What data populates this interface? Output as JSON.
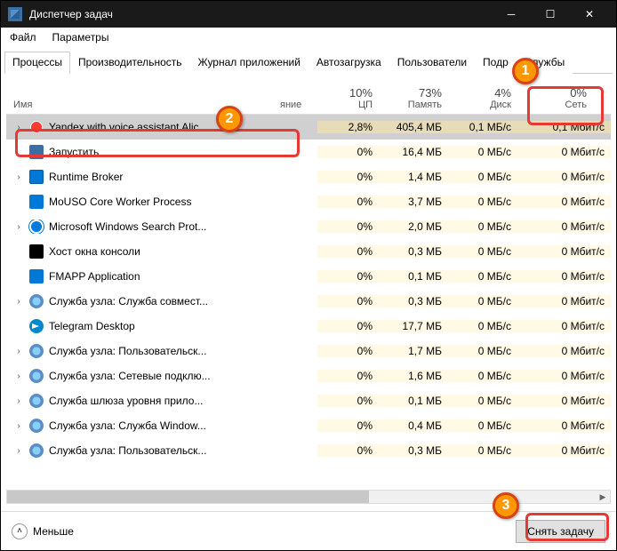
{
  "window": {
    "title": "Диспетчер задач"
  },
  "menu": {
    "file": "Файл",
    "options": "Параметры"
  },
  "tabs": [
    "Процессы",
    "Производительность",
    "Журнал приложений",
    "Автозагрузка",
    "Пользователи",
    "Подр",
    "Службы"
  ],
  "columns": {
    "name": "Имя",
    "status": "яние",
    "cpu": {
      "pct": "10%",
      "label": "ЦП"
    },
    "mem": {
      "pct": "73%",
      "label": "Память"
    },
    "disk": {
      "pct": "4%",
      "label": "Диск"
    },
    "net": {
      "pct": "0%",
      "label": "Сеть"
    }
  },
  "rows": [
    {
      "expand": true,
      "icon": "ic-yandex",
      "name": "Yandex with voice assistant Alic...",
      "cpu": "2,8%",
      "mem": "405,4 МБ",
      "disk": "0,1 МБ/с",
      "net": "0,1 Мбит/с",
      "selected": true
    },
    {
      "expand": false,
      "icon": "ic-run",
      "name": "Запустить",
      "cpu": "0%",
      "mem": "16,4 МБ",
      "disk": "0 МБ/с",
      "net": "0 Мбит/с"
    },
    {
      "expand": true,
      "icon": "ic-rt",
      "name": "Runtime Broker",
      "cpu": "0%",
      "mem": "1,4 МБ",
      "disk": "0 МБ/с",
      "net": "0 Мбит/с"
    },
    {
      "expand": false,
      "icon": "ic-mo",
      "name": "MoUSO Core Worker Process",
      "cpu": "0%",
      "mem": "3,7 МБ",
      "disk": "0 МБ/с",
      "net": "0 Мбит/с"
    },
    {
      "expand": true,
      "icon": "ic-search",
      "name": "Microsoft Windows Search Prot...",
      "cpu": "0%",
      "mem": "2,0 МБ",
      "disk": "0 МБ/с",
      "net": "0 Мбит/с"
    },
    {
      "expand": false,
      "icon": "ic-console",
      "name": "Хост окна консоли",
      "cpu": "0%",
      "mem": "0,3 МБ",
      "disk": "0 МБ/с",
      "net": "0 Мбит/с"
    },
    {
      "expand": false,
      "icon": "ic-fm",
      "name": "FMAPP Application",
      "cpu": "0%",
      "mem": "0,1 МБ",
      "disk": "0 МБ/с",
      "net": "0 Мбит/с"
    },
    {
      "expand": true,
      "icon": "ic-gear",
      "name": "Служба узла: Служба совмест...",
      "cpu": "0%",
      "mem": "0,3 МБ",
      "disk": "0 МБ/с",
      "net": "0 Мбит/с"
    },
    {
      "expand": false,
      "icon": "ic-tg",
      "name": "Telegram Desktop",
      "cpu": "0%",
      "mem": "17,7 МБ",
      "disk": "0 МБ/с",
      "net": "0 Мбит/с"
    },
    {
      "expand": true,
      "icon": "ic-gear",
      "name": "Служба узла: Пользовательск...",
      "cpu": "0%",
      "mem": "1,7 МБ",
      "disk": "0 МБ/с",
      "net": "0 Мбит/с"
    },
    {
      "expand": true,
      "icon": "ic-gear",
      "name": "Служба узла: Сетевые подклю...",
      "cpu": "0%",
      "mem": "1,6 МБ",
      "disk": "0 МБ/с",
      "net": "0 Мбит/с"
    },
    {
      "expand": true,
      "icon": "ic-gear",
      "name": "Служба шлюза уровня прило...",
      "cpu": "0%",
      "mem": "0,1 МБ",
      "disk": "0 МБ/с",
      "net": "0 Мбит/с"
    },
    {
      "expand": true,
      "icon": "ic-gear",
      "name": "Служба узла: Служба Window...",
      "cpu": "0%",
      "mem": "0,4 МБ",
      "disk": "0 МБ/с",
      "net": "0 Мбит/с"
    },
    {
      "expand": true,
      "icon": "ic-gear",
      "name": "Служба узла: Пользовательск...",
      "cpu": "0%",
      "mem": "0,3 МБ",
      "disk": "0 МБ/с",
      "net": "0 Мбит/с"
    }
  ],
  "footer": {
    "less": "Меньше",
    "endtask": "Снять задачу"
  },
  "badges": {
    "b1": "1",
    "b2": "2",
    "b3": "3"
  }
}
